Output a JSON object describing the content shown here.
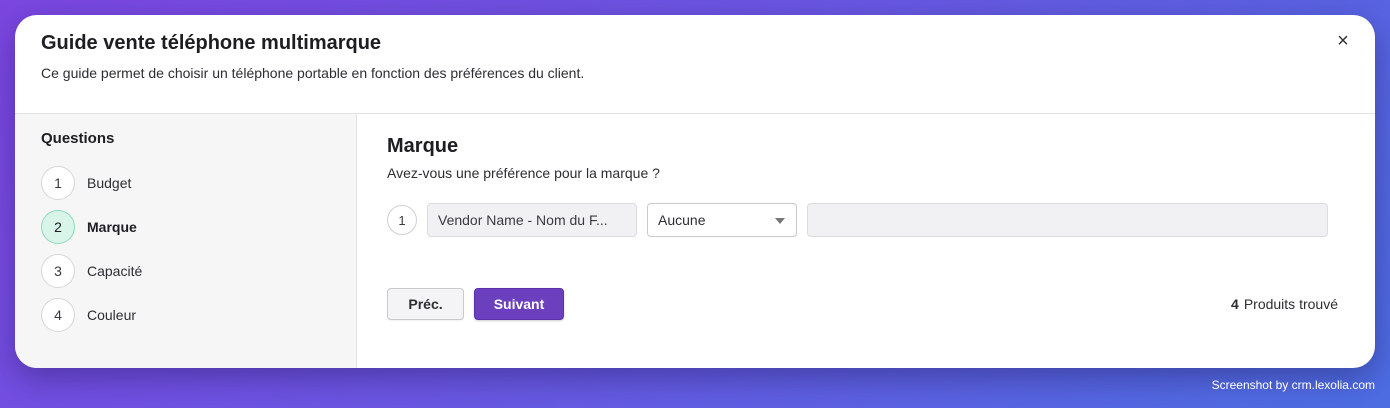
{
  "modal": {
    "title": "Guide vente téléphone multimarque",
    "subtitle": "Ce guide permet de choisir un téléphone portable en fonction des préférences du client.",
    "close_icon": "×"
  },
  "sidebar": {
    "title": "Questions",
    "steps": [
      {
        "number": "1",
        "label": "Budget"
      },
      {
        "number": "2",
        "label": "Marque",
        "active": true
      },
      {
        "number": "3",
        "label": "Capacité"
      },
      {
        "number": "4",
        "label": "Couleur"
      }
    ]
  },
  "question": {
    "title": "Marque",
    "text": "Avez-vous une préférence pour la marque ?",
    "criteria": {
      "number": "1",
      "field": "Vendor Name - Nom du F...",
      "operator": "Aucune",
      "value": ""
    }
  },
  "buttons": {
    "prev_label": "Préc.",
    "next_label": "Suivant"
  },
  "results": {
    "count": "4",
    "label": "Produits trouvé"
  },
  "footer": {
    "credit": "Screenshot by crm.lexolia.com"
  },
  "colors": {
    "accent": "#6b3fbe",
    "active_step_bg": "#d9f5ea",
    "background_gradient_start": "#7b46e0",
    "background_gradient_end": "#4c6de2"
  }
}
